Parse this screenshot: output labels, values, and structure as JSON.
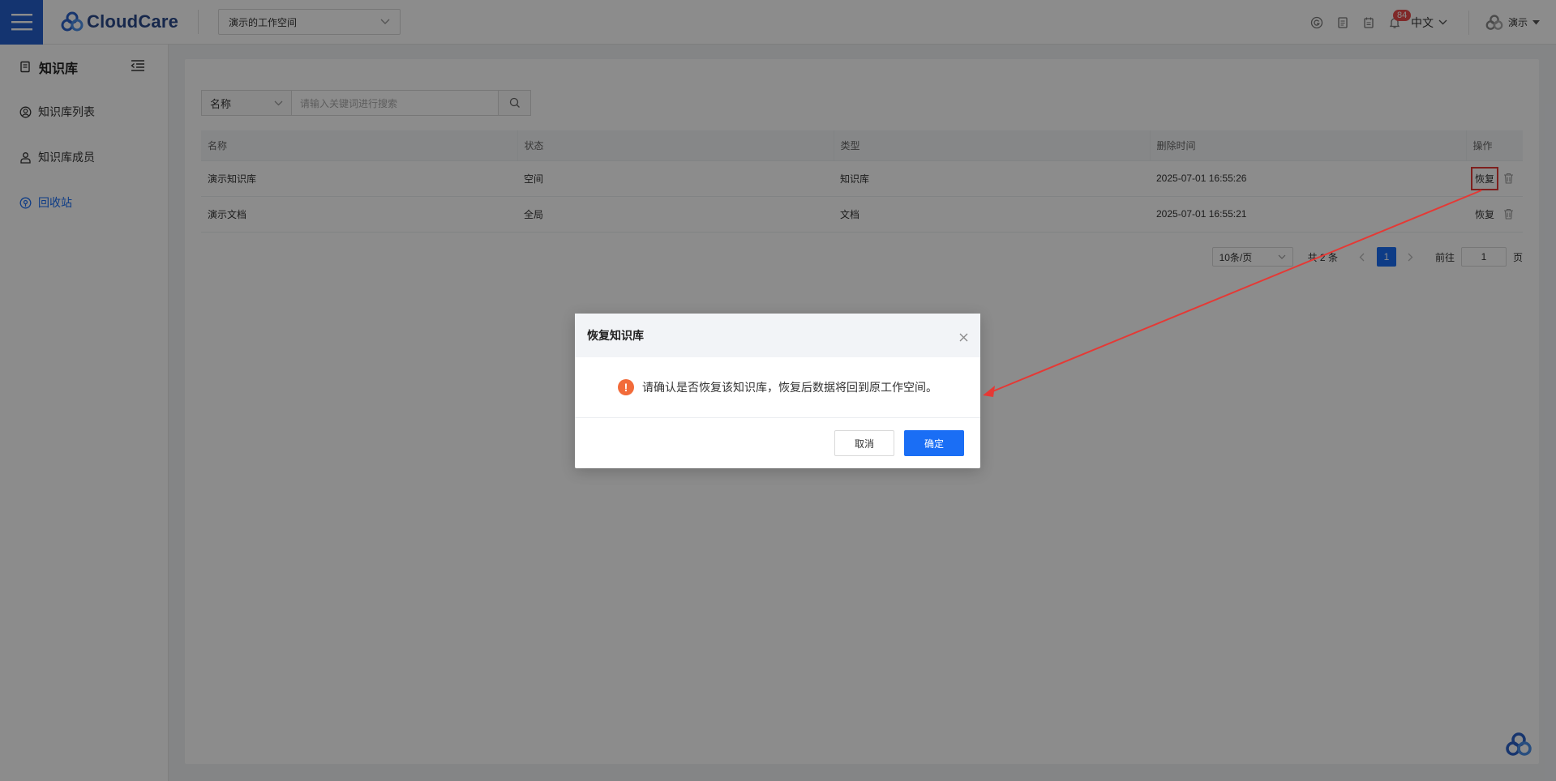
{
  "header": {
    "logo_text": "CloudCare",
    "workspace": "演示的工作空间",
    "notification_count": "84",
    "language": "中文",
    "user_name": "演示"
  },
  "sidebar": {
    "title": "知识库",
    "items": [
      {
        "label": "知识库列表",
        "icon": "user-circle-icon"
      },
      {
        "label": "知识库成员",
        "icon": "person-icon"
      },
      {
        "label": "回收站",
        "icon": "recycle-icon",
        "active": true
      }
    ]
  },
  "search": {
    "field": "名称",
    "placeholder": "请输入关键词进行搜索"
  },
  "table": {
    "columns": [
      "名称",
      "状态",
      "类型",
      "删除时间",
      "操作"
    ],
    "rows": [
      {
        "name": "演示知识库",
        "status": "空间",
        "type": "知识库",
        "deleted_at": "2025-07-01 16:55:26",
        "action": "恢复"
      },
      {
        "name": "演示文档",
        "status": "全局",
        "type": "文档",
        "deleted_at": "2025-07-01 16:55:21",
        "action": "恢复"
      }
    ]
  },
  "pagination": {
    "page_size": "10条/页",
    "total_prefix": "共",
    "total": "2",
    "total_suffix": "条",
    "current_page": "1",
    "goto_label": "前往",
    "goto_value": "1",
    "goto_suffix": "页"
  },
  "dialog": {
    "title": "恢复知识库",
    "message": "请确认是否恢复该知识库，恢复后数据将回到原工作空间。",
    "cancel": "取消",
    "confirm": "确定"
  },
  "colors": {
    "primary": "#1a6ef5",
    "menu_bg": "#2660cc",
    "warning": "#f26b3a",
    "annotation": "#e53935"
  }
}
